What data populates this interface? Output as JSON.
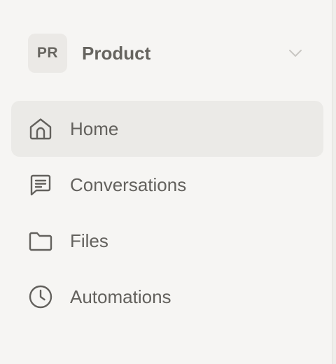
{
  "workspace": {
    "initials": "PR",
    "name": "Product",
    "chevron_icon": "chevron-down-icon"
  },
  "nav": {
    "items": [
      {
        "label": "Home",
        "icon": "home-icon",
        "active": true
      },
      {
        "label": "Conversations",
        "icon": "message-square-icon",
        "active": false
      },
      {
        "label": "Files",
        "icon": "folder-icon",
        "active": false
      },
      {
        "label": "Automations",
        "icon": "clock-icon",
        "active": false
      }
    ]
  },
  "colors": {
    "background": "#f6f5f3",
    "active_item": "#ebeae7",
    "text": "#63615d",
    "avatar_bg": "#ebe9e6"
  }
}
